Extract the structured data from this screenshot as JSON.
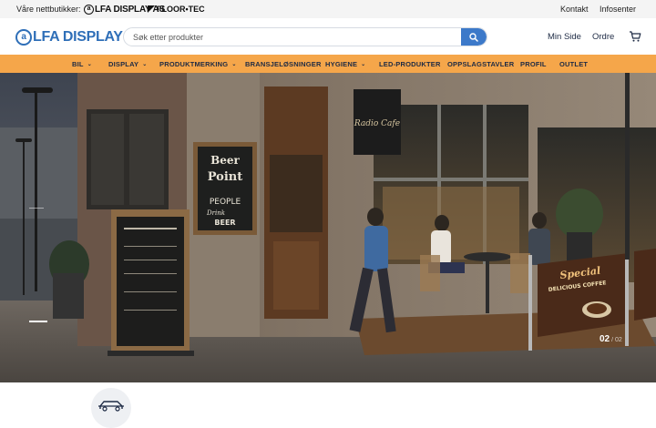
{
  "topbar": {
    "stores_label": "Våre nettbutikker:",
    "store_alfa": "LFA DISPLAY AS",
    "store_floor": "FLOOR•TEC",
    "contact": "Kontakt",
    "info": "Infosenter"
  },
  "header": {
    "logo_text": "LFA DISPLAY AS",
    "search_placeholder": "Søk etter produkter",
    "min_side": "Min Side",
    "ordre": "Ordre"
  },
  "nav": {
    "items": [
      {
        "label": "BIL",
        "dropdown": true
      },
      {
        "label": "DISPLAY",
        "dropdown": true
      },
      {
        "label": "PRODUKTMERKING",
        "dropdown": true
      },
      {
        "label": "BRANSJELØSNINGER",
        "dropdown": false
      },
      {
        "label": "HYGIENE",
        "dropdown": true
      },
      {
        "label": "LED-PRODUKTER",
        "dropdown": false
      },
      {
        "label": "OPPSLAGSTAVLER",
        "dropdown": false
      },
      {
        "label": "PROFIL",
        "dropdown": false
      },
      {
        "label": "OUTLET",
        "dropdown": false
      }
    ]
  },
  "hero": {
    "slide_current": "02",
    "slide_total": "/ 02",
    "sign_cafe": "Radio Cafe",
    "chalk_line1": "Beer",
    "chalk_line2": "Point",
    "chalk_line3": "PEOPLE",
    "chalk_line4": "Drink",
    "chalk_line5": "BEER",
    "banner_line1": "Special",
    "banner_line2": "DELICIOUS COFFEE"
  },
  "colors": {
    "accent_orange": "#f5a64a",
    "brand_blue": "#2f6fb8",
    "search_button": "#3c79c9"
  },
  "icons": [
    "search-icon",
    "cart-icon",
    "chevron-down-icon",
    "car-icon"
  ]
}
